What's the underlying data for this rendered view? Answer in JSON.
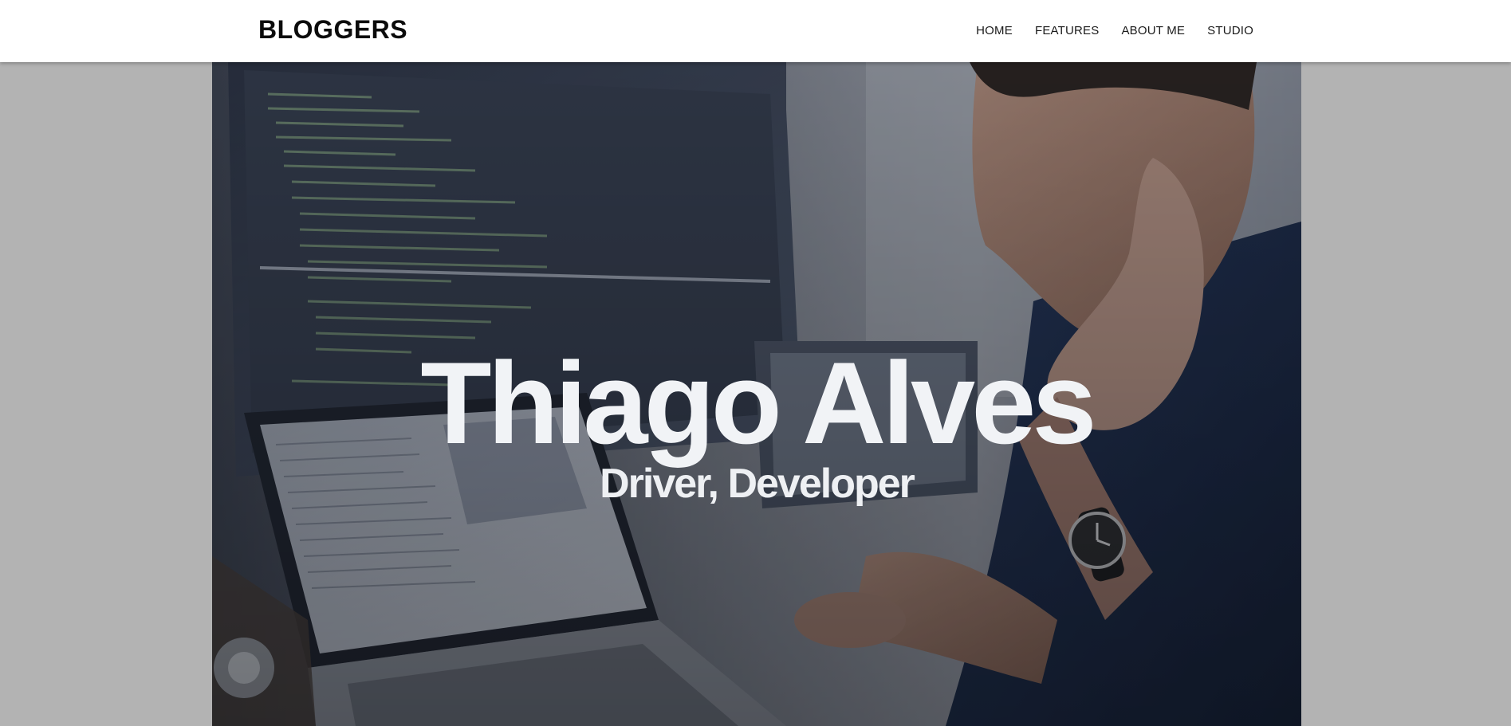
{
  "header": {
    "brand": "BLOGGERS",
    "nav": [
      {
        "label": "HOME"
      },
      {
        "label": "FEATURES"
      },
      {
        "label": "ABOUT ME"
      },
      {
        "label": "STUDIO"
      }
    ]
  },
  "hero": {
    "name": "Thiago Alves",
    "subtitle": "Driver, Developer",
    "image_icon": "developer-at-computer-photo"
  },
  "colors": {
    "page_background": "#b3b3b3",
    "navbar_background": "#ffffff",
    "hero_text": "#f1f3f6"
  }
}
